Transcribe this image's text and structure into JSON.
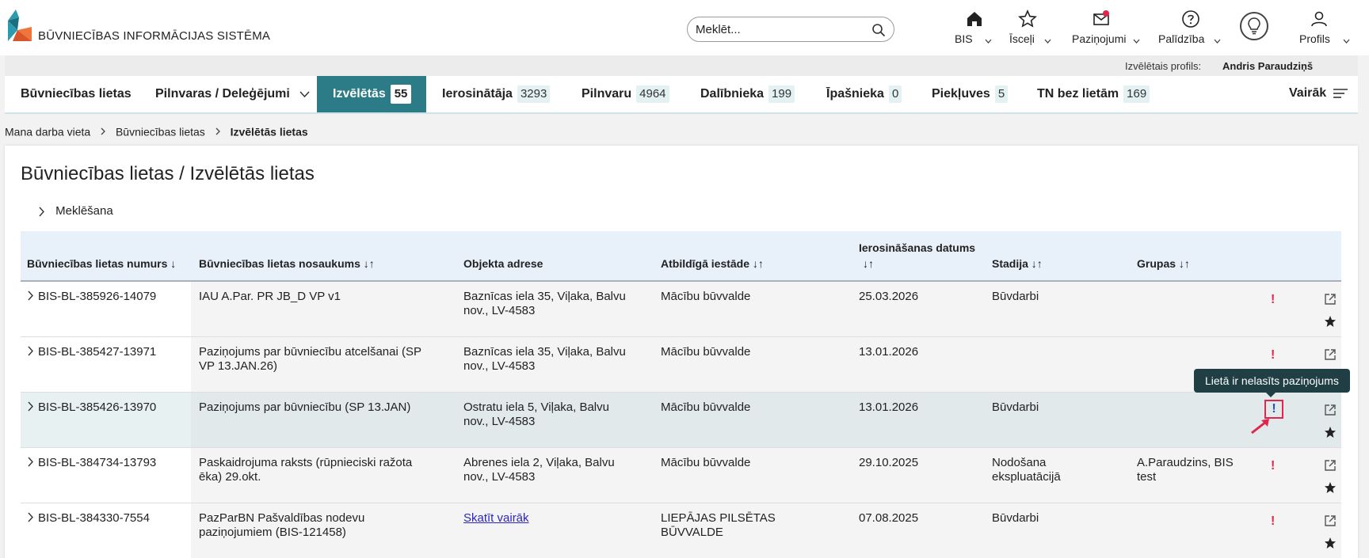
{
  "header": {
    "logo_text": "BŪVNIECĪBAS INFORMĀCIJAS SISTĒMA",
    "search_placeholder": "Meklēt...",
    "nav": [
      {
        "label": "BIS",
        "icon": "home-icon"
      },
      {
        "label": "Īsceļi",
        "icon": "star-icon"
      },
      {
        "label": "Paziņojumi",
        "icon": "mail-icon"
      },
      {
        "label": "Palīdzība",
        "icon": "help-icon"
      },
      {
        "label": "Profils",
        "icon": "user-icon"
      }
    ]
  },
  "profile_bar": {
    "label": "Izvēlētais profils:",
    "name": "Andris Paraudziņš"
  },
  "tabs": [
    {
      "label": "Būvniecības lietas",
      "count": ""
    },
    {
      "label": "Pilnvaras / Deleģējumi",
      "count": ""
    },
    {
      "label": "Izvēlētās",
      "count": "55"
    },
    {
      "label": "Ierosinātāja",
      "count": "3293"
    },
    {
      "label": "Pilnvaru",
      "count": "4964"
    },
    {
      "label": "Dalībnieka",
      "count": "199"
    },
    {
      "label": "Īpašnieka",
      "count": "0"
    },
    {
      "label": "Piekļuves",
      "count": "5"
    },
    {
      "label": "TN bez lietām",
      "count": "169"
    }
  ],
  "more_label": "Vairāk",
  "breadcrumb": [
    "Mana darba vieta",
    "Būvniecības lietas",
    "Izvēlētās lietas"
  ],
  "page_title": "Būvniecības lietas / Izvēlētās lietas",
  "search_toggle": "Meklēšana",
  "table": {
    "columns": [
      "Būvniecības lietas numurs ↓",
      "Būvniecības lietas nosaukums ↓↑",
      "Objekta adrese",
      "Atbildīgā iestāde ↓↑",
      "Ierosināšanas datums",
      "↓↑",
      "Stadija ↓↑",
      "Grupas ↓↑"
    ],
    "rows": [
      {
        "number": "BIS-BL-385926-14079",
        "name": "IAU A.Par. PR JB_D VP v1",
        "name2": "",
        "address": "Baznīcas iela 35, Viļaka, Balvu",
        "address2": "nov., LV-4583",
        "authority": "Mācību būvvalde",
        "authority2": "",
        "date": "25.03.2026",
        "stage": "Būvdarbi",
        "stage2": "",
        "groups": "",
        "groups2": "",
        "marker": "!"
      },
      {
        "number": "BIS-BL-385427-13971",
        "name": "Paziņojums par būvniecību atcelšanai (SP",
        "name2": "VP 13.JAN.26)",
        "address": "Baznīcas iela 35, Viļaka, Balvu",
        "address2": "nov., LV-4583",
        "authority": "Mācību būvvalde",
        "authority2": "",
        "date": "13.01.2026",
        "stage": "",
        "stage2": "",
        "groups": "",
        "groups2": "",
        "marker": "!"
      },
      {
        "number": "BIS-BL-385426-13970",
        "name": "Paziņojums par būvniecību (SP 13.JAN)",
        "name2": "",
        "address": "Ostratu iela 5, Viļaka, Balvu",
        "address2": "nov., LV-4583",
        "authority": "Mācību būvvalde",
        "authority2": "",
        "date": "13.01.2026",
        "stage": "Būvdarbi",
        "stage2": "",
        "groups": "",
        "groups2": "",
        "marker": "!"
      },
      {
        "number": "BIS-BL-384734-13793",
        "name": "Paskaidrojuma raksts (rūpnieciski ražota",
        "name2": "ēka) 29.okt.",
        "address": "Abrenes iela 2, Viļaka, Balvu",
        "address2": "nov., LV-4583",
        "authority": "Mācību būvvalde",
        "authority2": "",
        "date": "29.10.2025",
        "stage": "Nodošana",
        "stage2": "ekspluatācijā",
        "groups": "A.Paraudzins, BIS",
        "groups2": "test",
        "marker": "!"
      },
      {
        "number": "BIS-BL-384330-7554",
        "name": "PazParBN Pašvaldības nodevu",
        "name2": "paziņojumiem (BIS-121458)",
        "address": "",
        "address2": "",
        "address_link": "Skatīt vairāk",
        "authority": "LIEPĀJAS PILSĒTAS",
        "authority2": "BŪVVALDE",
        "date": "07.08.2025",
        "stage": "Būvdarbi",
        "stage2": "",
        "groups": "",
        "groups2": "",
        "marker": "!"
      }
    ]
  },
  "tooltip": "Lietā ir nelasīts paziņojums",
  "colors": {
    "accent": "#2b7c86",
    "alert": "#e0264a",
    "link": "#2c24c8",
    "tooltip_bg": "#1f3f44"
  }
}
